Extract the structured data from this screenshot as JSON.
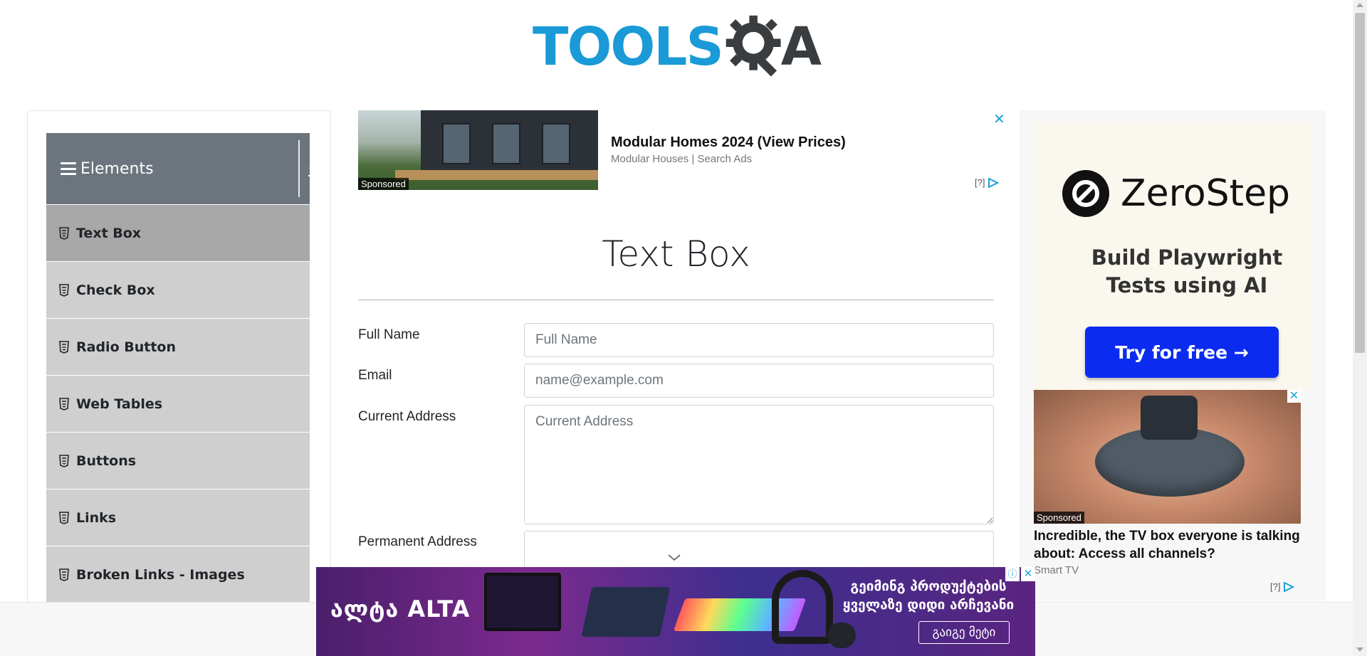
{
  "header": {
    "logo_text_primary": "TOOLS",
    "logo_text_secondary": "A",
    "logo_colors": {
      "tools": "#1a9ad6",
      "gear": "#3a3d40"
    }
  },
  "sidebar": {
    "group_title": "Elements",
    "group_icon": "hamburger-icon",
    "collapse_icon": "upload-icon",
    "items": [
      {
        "label": "Text Box",
        "icon": "html5-icon",
        "active": true
      },
      {
        "label": "Check Box",
        "icon": "html5-icon",
        "active": false
      },
      {
        "label": "Radio Button",
        "icon": "html5-icon",
        "active": false
      },
      {
        "label": "Web Tables",
        "icon": "html5-icon",
        "active": false
      },
      {
        "label": "Buttons",
        "icon": "html5-icon",
        "active": false
      },
      {
        "label": "Links",
        "icon": "html5-icon",
        "active": false
      },
      {
        "label": "Broken Links - Images",
        "icon": "html5-icon",
        "active": false
      }
    ],
    "colors": {
      "header": "#6c757d",
      "item": "#cfcfcf",
      "item_active": "#a8a8a8"
    }
  },
  "top_ad": {
    "badge": "Sponsored",
    "title": "Modular Homes 2024 (View Prices)",
    "subtitle": "Modular Houses | Search Ads",
    "meta": "[?]",
    "close": "✕"
  },
  "form": {
    "title": "Text Box",
    "fields": [
      {
        "label": "Full Name",
        "placeholder": "Full Name",
        "value": ""
      },
      {
        "label": "Email",
        "placeholder": "name@example.com",
        "value": ""
      },
      {
        "label": "Current Address",
        "placeholder": "Current Address",
        "value": ""
      },
      {
        "label": "Permanent Address",
        "placeholder": "",
        "value": ""
      }
    ]
  },
  "right_ad": {
    "brand": "ZeroStep",
    "tagline_line1": "Build Playwright",
    "tagline_line2": "Tests using AI",
    "cta": "Try for free →",
    "badge": "Sponsored",
    "title": "Incredible, the TV box everyone is talking about: Access all channels?",
    "subtitle": "Smart TV",
    "meta": "[?]",
    "close": "✕",
    "colors": {
      "cta": "#0b2cf0"
    }
  },
  "bottom_ad": {
    "brand": "ALTA",
    "brand_prefix": "ალტა",
    "headline_line1": "გეიმინგ პროდუქტების",
    "headline_line2": "ყველაზე დიდი არჩევანი",
    "cta": "გაიგე მეტი",
    "close": "✕",
    "info": "ⓘ"
  }
}
